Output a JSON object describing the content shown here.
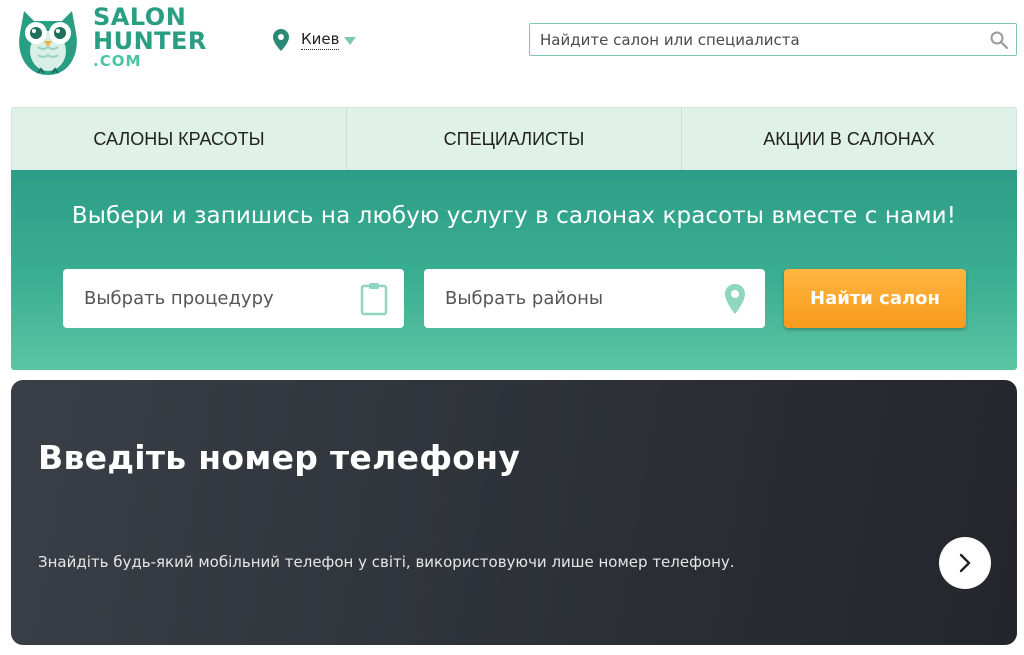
{
  "header": {
    "logo": {
      "line1": "SALON",
      "line2": "HUNTER",
      "line3": ".COM"
    },
    "city": {
      "name": "Киев",
      "pin_icon": "map-pin-icon",
      "arrow_icon": "caret-down-icon"
    },
    "search": {
      "placeholder": "Найдите салон или специалиста",
      "value": "",
      "icon": "search-icon"
    }
  },
  "tabs": [
    {
      "label": "САЛОНЫ КРАСОТЫ"
    },
    {
      "label": "СПЕЦИАЛИСТЫ"
    },
    {
      "label": "АКЦИИ В САЛОНАХ"
    }
  ],
  "hero": {
    "title": "Выбери и запишись на любую услугу в салонах красоты вместе с нами!",
    "procedure": {
      "label": "Выбрать процедуру",
      "icon": "clipboard-icon"
    },
    "district": {
      "label": "Выбрать районы",
      "icon": "map-pin-icon"
    },
    "find_button": "Найти салон"
  },
  "promo_card": {
    "title": "Введіть номер телефону",
    "description": "Знайдіть будь-який мобільний телефон у світі, використовуючи лише номер телефону.",
    "next_icon": "chevron-right-icon"
  },
  "colors": {
    "brand_green": "#2a9e83",
    "hero_top": "#2e9d87",
    "hero_bottom": "#5cc5a3",
    "tab_bg": "#dff1e9",
    "button_orange": "#f89a1c",
    "card_bg": "#2f333a"
  }
}
